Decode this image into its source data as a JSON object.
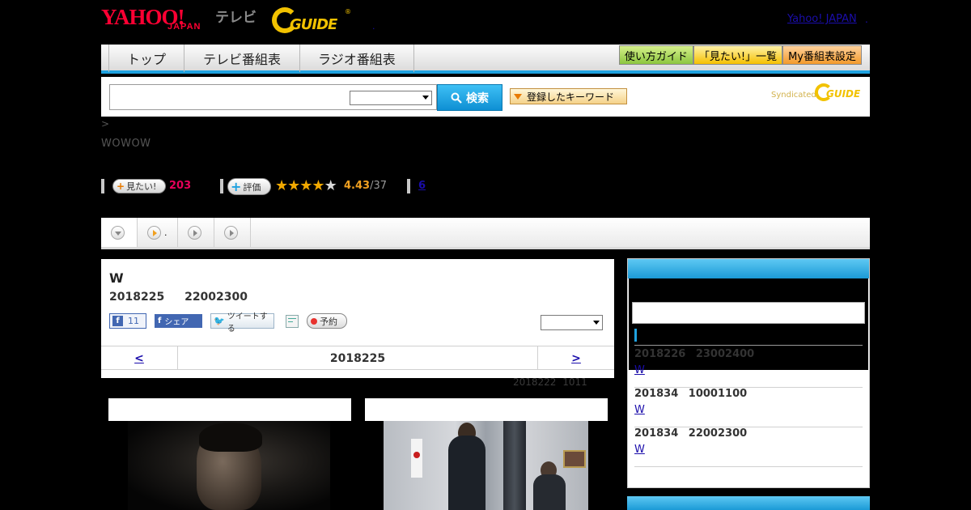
{
  "header": {
    "logo_main": "YAHOO!",
    "logo_sub": "JAPAN",
    "logo_tv": "テレビ",
    "logo_guide": "GUIDE",
    "logo_reg": "®",
    "dot": ".",
    "yahoo_japan_link": "Yahoo! JAPAN",
    "link_dot": "."
  },
  "nav": {
    "tabs": [
      "トップ",
      "テレビ番組表",
      "ラジオ番組表"
    ],
    "guide_button": "使い方ガイド",
    "mitai_list_button": "「見たい!」一覧",
    "my_schedule_button": "My番組表設定"
  },
  "search": {
    "query": "",
    "category_selected": "",
    "submit_label": "検索",
    "search_icon": "search-icon",
    "keyword_button": "登録したキーワード",
    "syndicated_label": "Syndicated",
    "syndicated_guide": "GUIDE"
  },
  "breadcrumb": ">",
  "channel_name": "WOWOW",
  "stats": {
    "mitai_label": "見たい!",
    "mitai_plus": "+",
    "mitai_count": "203",
    "rating_label": "評価",
    "rating_plus": "+",
    "rating_stars": 4.5,
    "rating_score": "4.43",
    "rating_total": "/37",
    "review_count": "6"
  },
  "subtabs": [
    {
      "label": "",
      "icon": "chevron-down-icon"
    },
    {
      "label": ".",
      "icon": "play-icon"
    },
    {
      "label": "",
      "icon": "play-icon"
    },
    {
      "label": "",
      "icon": "play-icon"
    }
  ],
  "program": {
    "title": "W",
    "date": "2018225",
    "time": "22002300",
    "like_label": "11",
    "share_label": "シェア",
    "tweet_label": "ツイートする",
    "reserve_label": "予約",
    "select_value": "",
    "pager_prev": "<",
    "pager_current": "2018225",
    "pager_next": ">",
    "updated_date": "2018222",
    "updated_time": "1011"
  },
  "sidebar": {
    "search_value": "",
    "items": [
      {
        "datetime": "2018226  23002400",
        "link": "W"
      },
      {
        "datetime": "201834  10001100",
        "link": "W"
      },
      {
        "datetime": "201834  22002300",
        "link": "W"
      }
    ]
  },
  "colors": {
    "accent_blue": "#1fa2e0",
    "pink_count": "#e8005a",
    "star_gold": "#f2a900",
    "guide_yellow": "#f2c200"
  }
}
